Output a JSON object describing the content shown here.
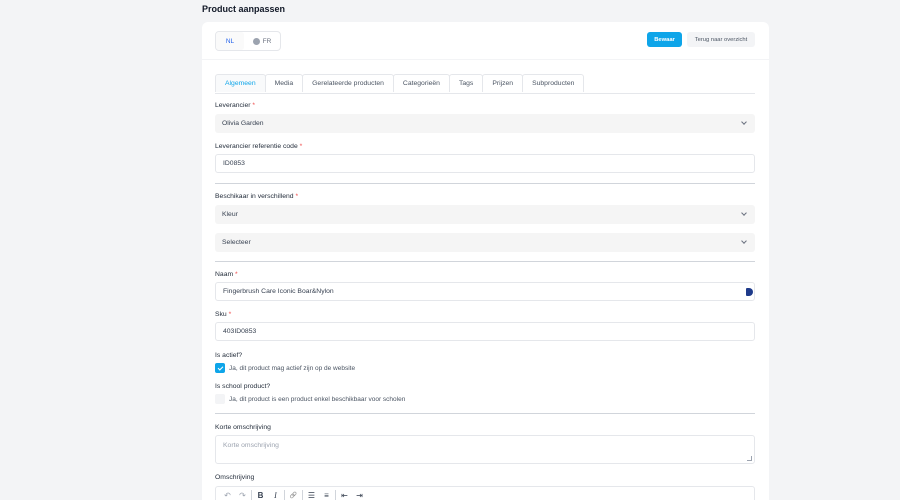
{
  "page": {
    "title": "Product aanpassen"
  },
  "header": {
    "languages": [
      {
        "code": "NL"
      },
      {
        "code": "FR"
      }
    ],
    "save_label": "Bewaar",
    "back_label": "Terug naar overzicht"
  },
  "tabs": [
    {
      "label": "Algemeen"
    },
    {
      "label": "Media"
    },
    {
      "label": "Gerelateerde producten"
    },
    {
      "label": "Categorieën"
    },
    {
      "label": "Tags"
    },
    {
      "label": "Prijzen"
    },
    {
      "label": "Subproducten"
    }
  ],
  "form": {
    "supplier": {
      "label": "Leverancier",
      "value": "Olivia Garden"
    },
    "supplier_ref": {
      "label": "Leverancier referentie code",
      "value": "ID0853"
    },
    "variants": {
      "label": "Beschikaar in verschillend",
      "value": "Kleur",
      "placeholder": "Selecteer"
    },
    "name": {
      "label": "Naam",
      "value": "Fingerbrush Care Iconic Boar&Nylon"
    },
    "sku": {
      "label": "Sku",
      "value": "403ID0853"
    },
    "active": {
      "label": "Is actief?",
      "checkbox_label": "Ja, dit product mag actief zijn op de website",
      "checked": true
    },
    "school": {
      "label": "Is school product?",
      "checkbox_label": "Ja, dit product is een product enkel beschikbaar voor scholen",
      "checked": false
    },
    "short_desc": {
      "label": "Korte omschrijving",
      "placeholder": "Korte omschrijving"
    },
    "description": {
      "label": "Omschrijving"
    }
  },
  "required_mark": "*",
  "toolbar_glyphs": {
    "undo": "↶",
    "redo": "↷",
    "bold": "B",
    "italic": "I",
    "link": "🔗",
    "bullet": "☰",
    "numbered": "≡",
    "outdent": "⇤",
    "indent": "⇥"
  },
  "colors": {
    "accent": "#0ea5e9",
    "required": "#ef4444"
  }
}
